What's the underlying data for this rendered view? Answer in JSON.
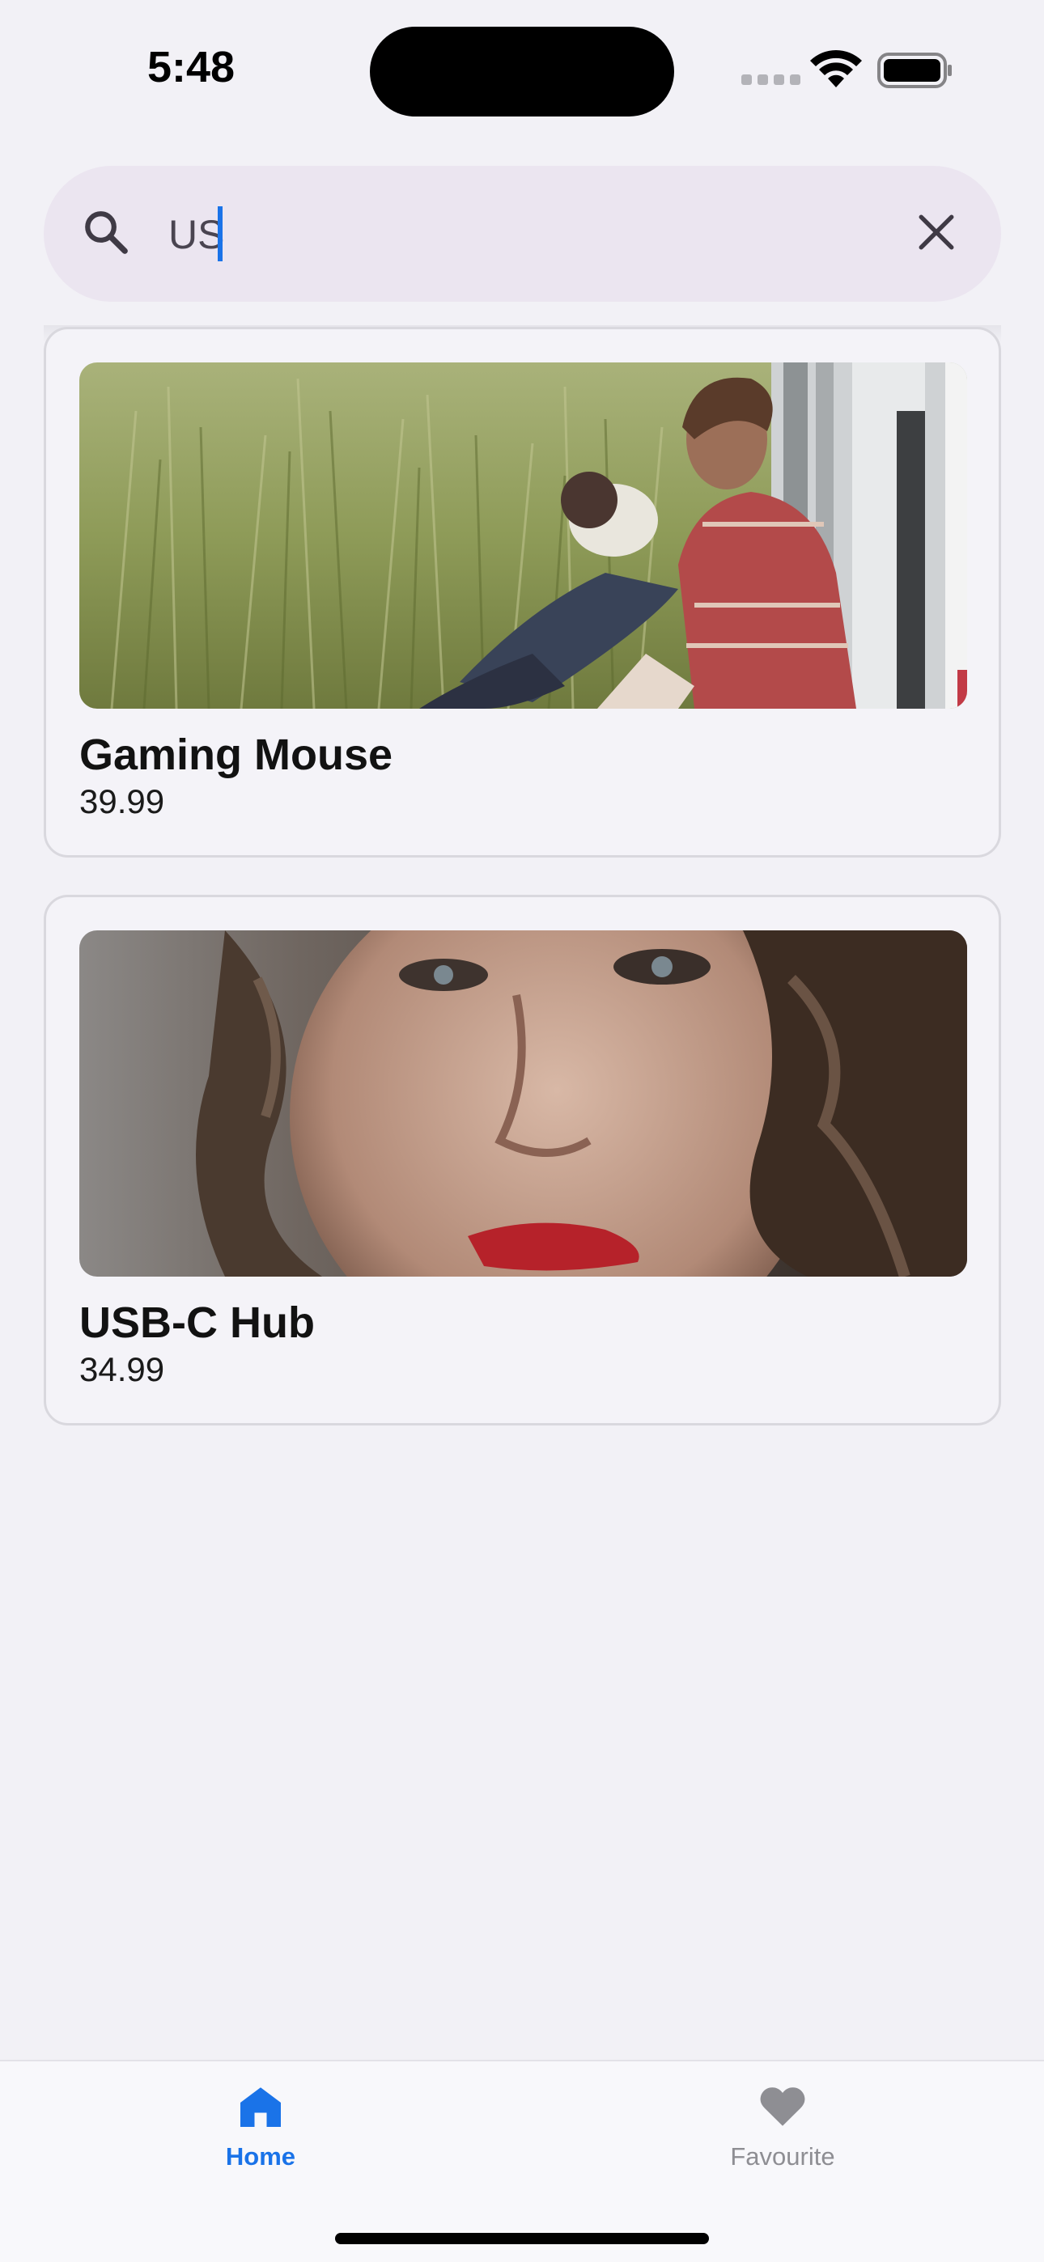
{
  "status_bar": {
    "time": "5:48"
  },
  "search": {
    "value": "US",
    "icon": "search-icon",
    "clear_icon": "close-icon"
  },
  "products": [
    {
      "name": "Gaming Mouse",
      "price": "39.99",
      "image": "man-and-dog-in-grass-photo"
    },
    {
      "name": "USB-C Hub",
      "price": "34.99",
      "image": "woman-portrait-photo"
    }
  ],
  "tabs": [
    {
      "label": "Home",
      "icon": "home-icon",
      "active": true
    },
    {
      "label": "Favourite",
      "icon": "heart-icon",
      "active": false
    }
  ],
  "colors": {
    "accent": "#1a73e8",
    "inactive": "#8e8e93",
    "search_background": "#ebe5f0"
  }
}
